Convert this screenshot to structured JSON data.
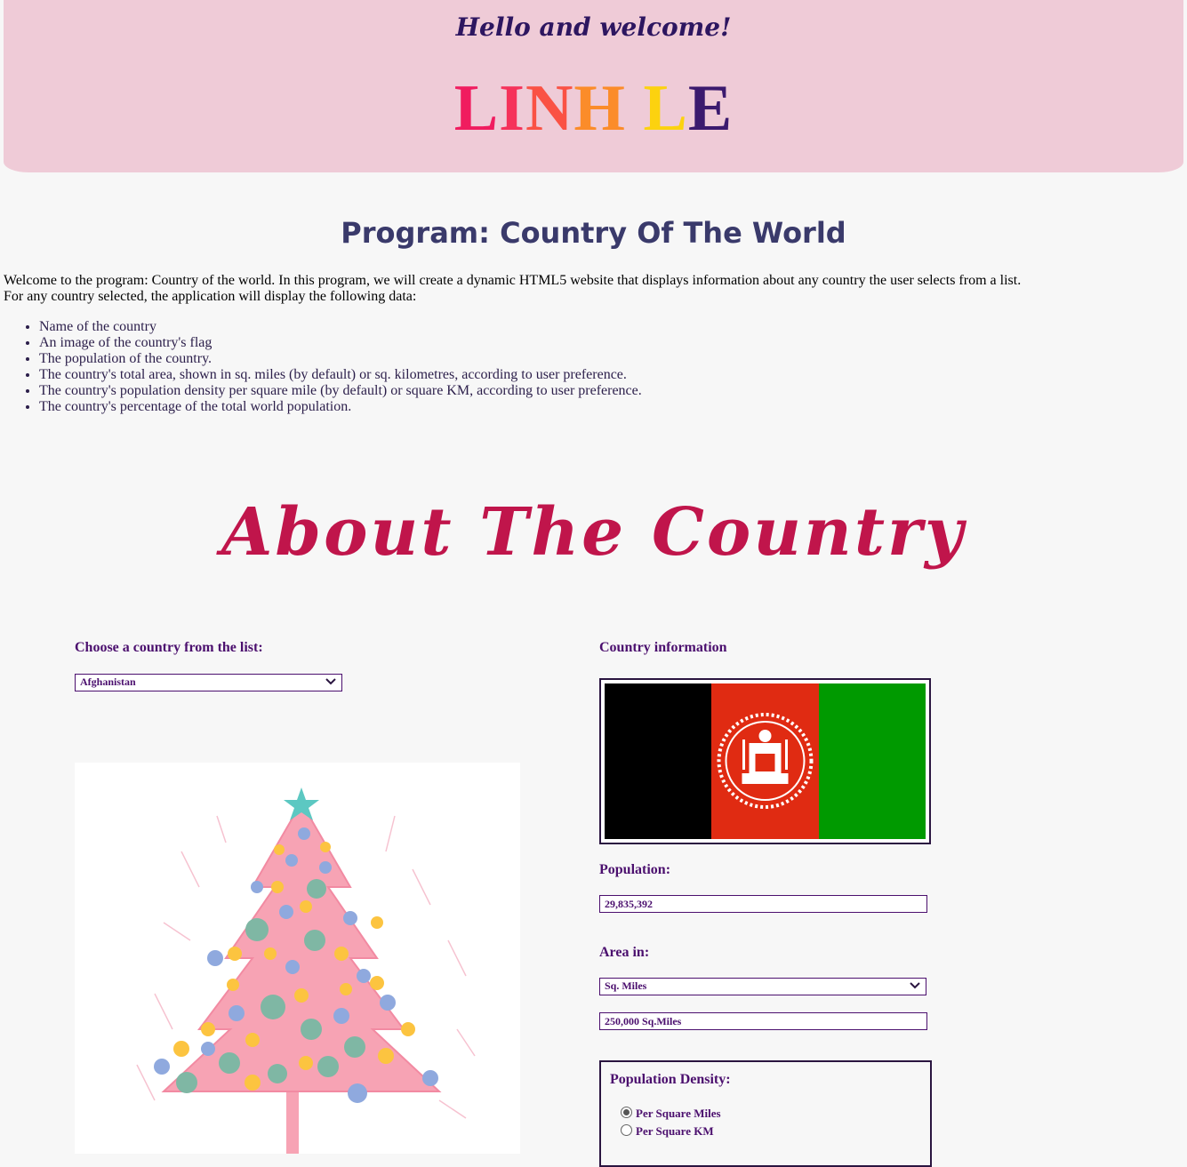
{
  "header": {
    "greeting": "Hello and welcome!",
    "name_letters": [
      {
        "char": "L",
        "color": "#f01c5f"
      },
      {
        "char": "I",
        "color": "#f5325a"
      },
      {
        "char": "N",
        "color": "#fa5244"
      },
      {
        "char": "H",
        "color": "#fb8c2a"
      },
      {
        "char": " ",
        "color": "#000000"
      },
      {
        "char": "L",
        "color": "#fcd20f"
      },
      {
        "char": "E",
        "color": "#3b1a6e"
      }
    ],
    "name_full": "LINH LE",
    "background_color": "#efcbd7"
  },
  "program": {
    "title": "Program: Country Of The World",
    "intro_line1": "Welcome to the program: Country of the world. In this program, we will create a dynamic HTML5 website that displays information about any country the user selects from a list.",
    "intro_line2": "For any country selected, the application will display the following data:",
    "features": [
      "Name of the country",
      "An image of the country's flag",
      "The population of the country.",
      "The country's total area, shown in sq. miles (by default) or sq. kilometres, according to user preference.",
      "The country's population density per square mile (by default) or square KM, according to user preference.",
      "The country's percentage of the total world population."
    ]
  },
  "about": {
    "title": "About The Country"
  },
  "selector": {
    "label": "Choose a country from the list:",
    "selected_country": "Afghanistan"
  },
  "info": {
    "label": "Country information",
    "flag_icon": "afghanistan-flag",
    "population_label": "Population:",
    "population_value": "29,835,392",
    "area_label": "Area in:",
    "area_unit": "Sq. Miles",
    "area_value": "250,000 Sq.Miles",
    "density_label": "Population Density:",
    "density_options": [
      "Per Square Miles",
      "Per Square KM"
    ],
    "density_selected": "Per Square Miles"
  },
  "decoration": {
    "image": "christmas-tree-illustration"
  }
}
